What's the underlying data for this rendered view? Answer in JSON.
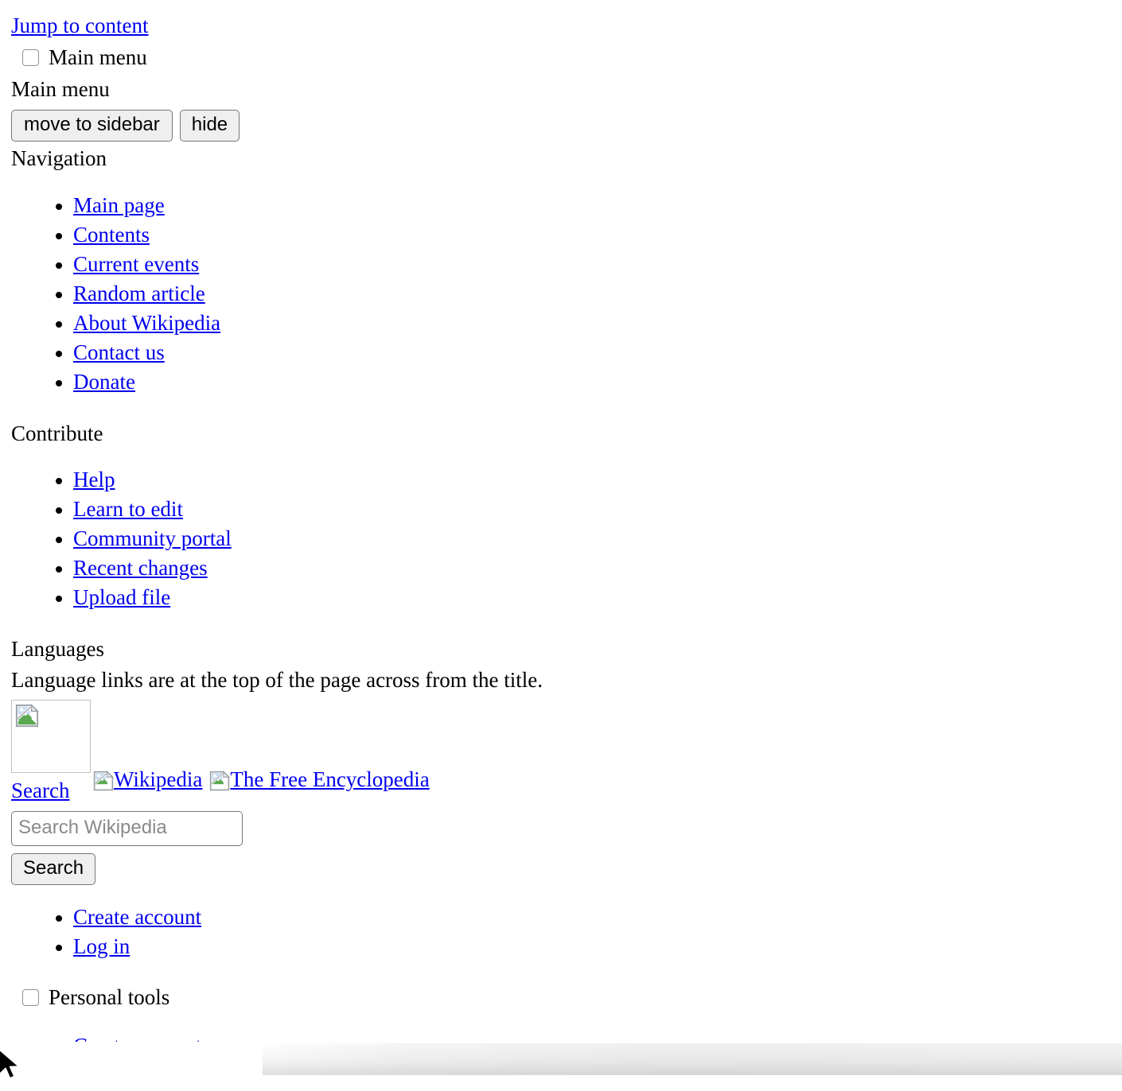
{
  "colors": {
    "link": "#0000ee",
    "text": "#000000",
    "background": "#ffffff",
    "button_face": "#efefef",
    "control_border": "#767676",
    "placeholder": "#8a8a8a",
    "image_frame_border": "#c0c0c0"
  },
  "skip": {
    "jump_to_content": "Jump to content"
  },
  "main_menu_toggle": {
    "label": "Main menu"
  },
  "main_menu": {
    "heading": "Main menu",
    "move_to_sidebar_label": "move to sidebar",
    "hide_label": "hide"
  },
  "navigation": {
    "heading": "Navigation",
    "items": [
      {
        "label": "Main page"
      },
      {
        "label": "Contents"
      },
      {
        "label": "Current events"
      },
      {
        "label": "Random article"
      },
      {
        "label": "About Wikipedia"
      },
      {
        "label": "Contact us"
      },
      {
        "label": "Donate"
      }
    ]
  },
  "contribute": {
    "heading": "Contribute",
    "items": [
      {
        "label": "Help"
      },
      {
        "label": "Learn to edit"
      },
      {
        "label": "Community portal"
      },
      {
        "label": "Recent changes"
      },
      {
        "label": "Upload file"
      }
    ]
  },
  "languages": {
    "heading": "Languages",
    "note": "Language links are at the top of the page across from the title."
  },
  "logo": {
    "frame_icon": "broken-image-icon",
    "wordmark_alt": "Wikipedia",
    "tagline_alt": "The Free Encyclopedia"
  },
  "search": {
    "heading": "Search",
    "placeholder": "Search Wikipedia",
    "value": "",
    "submit_label": "Search"
  },
  "account_links": {
    "items": [
      {
        "label": "Create account"
      },
      {
        "label": "Log in"
      }
    ]
  },
  "personal_tools_toggle": {
    "label": "Personal tools"
  },
  "personal_tools": {
    "items": [
      {
        "label": "Create account"
      }
    ]
  }
}
